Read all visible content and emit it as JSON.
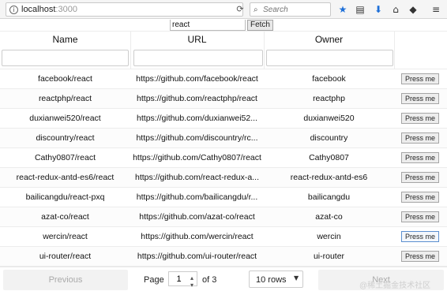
{
  "browser": {
    "url_host": "localhost",
    "url_port": ":3000",
    "search_placeholder": "Search"
  },
  "search_form": {
    "query": "react",
    "fetch_label": "Fetch"
  },
  "table": {
    "headers": [
      "Name",
      "URL",
      "Owner"
    ],
    "rows": [
      {
        "name": "facebook/react",
        "url": "https://github.com/facebook/react",
        "owner": "facebook",
        "button": "Press me"
      },
      {
        "name": "reactphp/react",
        "url": "https://github.com/reactphp/react",
        "owner": "reactphp",
        "button": "Press me"
      },
      {
        "name": "duxianwei520/react",
        "url": "https://github.com/duxianwei52...",
        "owner": "duxianwei520",
        "button": "Press me"
      },
      {
        "name": "discountry/react",
        "url": "https://github.com/discountry/rc...",
        "owner": "discountry",
        "button": "Press me"
      },
      {
        "name": "Cathy0807/react",
        "url": "https://github.com/Cathy0807/react",
        "owner": "Cathy0807",
        "button": "Press me"
      },
      {
        "name": "react-redux-antd-es6/react",
        "url": "https://github.com/react-redux-a...",
        "owner": "react-redux-antd-es6",
        "button": "Press me"
      },
      {
        "name": "bailicangdu/react-pxq",
        "url": "https://github.com/bailicangdu/r...",
        "owner": "bailicangdu",
        "button": "Press me"
      },
      {
        "name": "azat-co/react",
        "url": "https://github.com/azat-co/react",
        "owner": "azat-co",
        "button": "Press me"
      },
      {
        "name": "wercin/react",
        "url": "https://github.com/wercin/react",
        "owner": "wercin",
        "button": "Press me"
      },
      {
        "name": "ui-router/react",
        "url": "https://github.com/ui-router/react",
        "owner": "ui-router",
        "button": "Press me"
      }
    ]
  },
  "pagination": {
    "previous_label": "Previous",
    "next_label": "Next",
    "page_label": "Page",
    "current_page": "1",
    "of_label": "of 3",
    "rows_option": "10 rows"
  },
  "watermark": "@稀土掘金技术社区",
  "icons": {
    "reload": "reload-icon",
    "bookmark": "star-icon",
    "download": "download-icon",
    "home": "home-icon",
    "menu": "hamburger-icon"
  }
}
